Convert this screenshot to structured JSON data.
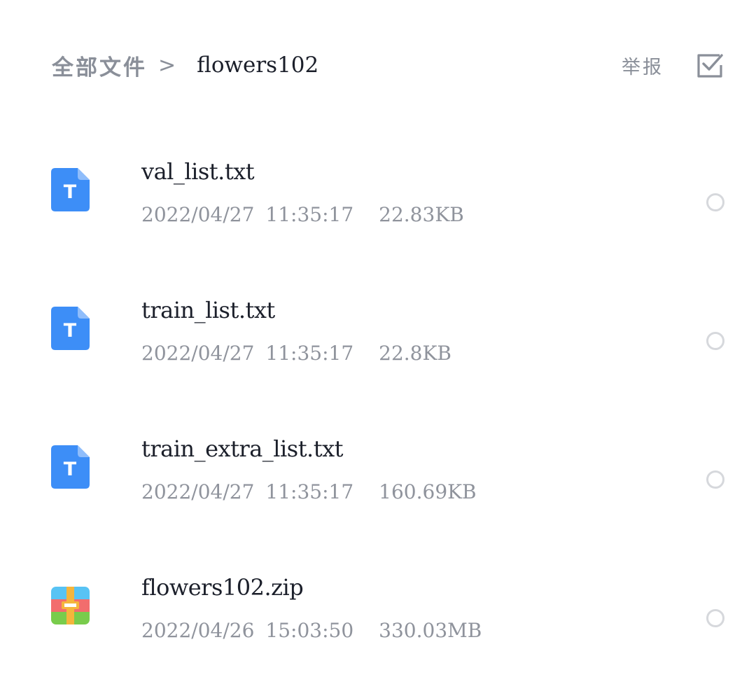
{
  "header": {
    "breadcrumb_root": "全部文件",
    "breadcrumb_separator": ">",
    "breadcrumb_current": "flowers102",
    "report_label": "举报",
    "select_all_icon": "checkbox-check-icon"
  },
  "colors": {
    "text_primary": "#1b1f2a",
    "text_secondary": "#8f939c",
    "txt_icon_blue": "#3d8ef7",
    "radio_border": "#d6d8dc"
  },
  "files": [
    {
      "name": "val_list.txt",
      "date": "2022/04/27",
      "time": "11:35:17",
      "size": "22.83KB",
      "icon": "text-file-icon",
      "icon_letter": "T"
    },
    {
      "name": "train_list.txt",
      "date": "2022/04/27",
      "time": "11:35:17",
      "size": "22.8KB",
      "icon": "text-file-icon",
      "icon_letter": "T"
    },
    {
      "name": "train_extra_list.txt",
      "date": "2022/04/27",
      "time": "11:35:17",
      "size": "160.69KB",
      "icon": "text-file-icon",
      "icon_letter": "T"
    },
    {
      "name": "flowers102.zip",
      "date": "2022/04/26",
      "time": "15:03:50",
      "size": "330.03MB",
      "icon": "zip-archive-icon"
    }
  ]
}
